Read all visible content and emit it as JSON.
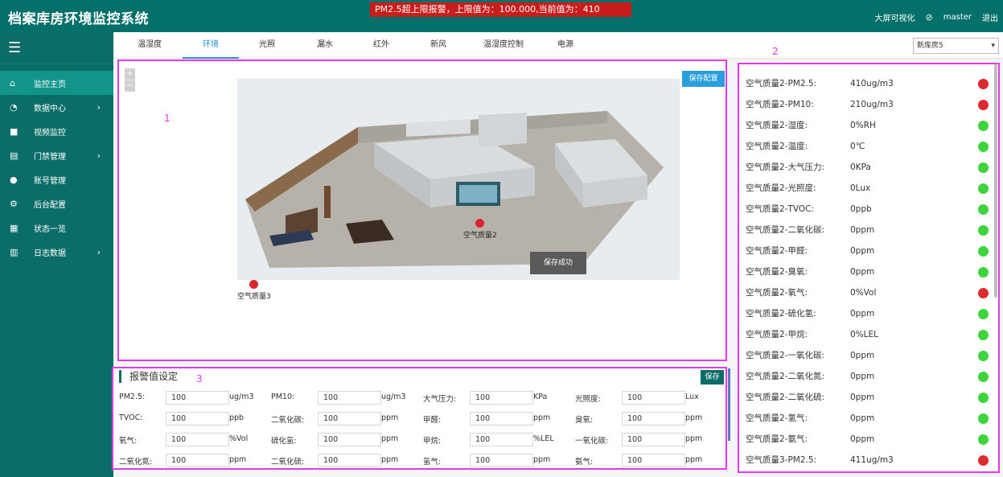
{
  "header": {
    "title": "档案库房环境监控系统",
    "alarm": "PM2.5超上限报警，上限值为：100.000,当前值为：410",
    "bigscreen": "大屏可视化",
    "user": "master",
    "logout": "退出"
  },
  "sidebar": {
    "items": [
      {
        "label": "监控主页",
        "icon": "home-icon"
      },
      {
        "label": "数据中心",
        "icon": "pie-chart-icon"
      },
      {
        "label": "视频监控",
        "icon": "video-camera-icon"
      },
      {
        "label": "门禁管理",
        "icon": "id-card-icon"
      },
      {
        "label": "账号管理",
        "icon": "user-icon"
      },
      {
        "label": "后台配置",
        "icon": "cogs-icon"
      },
      {
        "label": "状态一览",
        "icon": "list-icon"
      },
      {
        "label": "日志数据",
        "icon": "list-alt-icon"
      }
    ]
  },
  "tabs": [
    "温湿度",
    "环境",
    "光照",
    "漏水",
    "红外",
    "新风",
    "温湿度控制",
    "电源"
  ],
  "active_tab": "环境",
  "store_select": "新库房5",
  "panel_labels": {
    "p1": "1",
    "p2": "2",
    "p3": "3"
  },
  "map": {
    "save_config": "保存配置",
    "toast": "保存成功",
    "sensor2": "空气质量2",
    "sensor3": "空气质量3",
    "zoom_in": "+",
    "zoom_out": "−"
  },
  "status_list": [
    {
      "label": "空气质量2-PM2.5:",
      "value": "410ug/m3",
      "state": "red"
    },
    {
      "label": "空气质量2-PM10:",
      "value": "210ug/m3",
      "state": "red"
    },
    {
      "label": "空气质量2-湿度:",
      "value": "0%RH",
      "state": "green"
    },
    {
      "label": "空气质量2-温度:",
      "value": "0℃",
      "state": "green"
    },
    {
      "label": "空气质量2-大气压力:",
      "value": "0KPa",
      "state": "green"
    },
    {
      "label": "空气质量2-光照度:",
      "value": "0Lux",
      "state": "green"
    },
    {
      "label": "空气质量2-TVOC:",
      "value": "0ppb",
      "state": "green"
    },
    {
      "label": "空气质量2-二氧化碳:",
      "value": "0ppm",
      "state": "green"
    },
    {
      "label": "空气质量2-甲醛:",
      "value": "0ppm",
      "state": "green"
    },
    {
      "label": "空气质量2-臭氧:",
      "value": "0ppm",
      "state": "green"
    },
    {
      "label": "空气质量2-氧气:",
      "value": "0%Vol",
      "state": "red"
    },
    {
      "label": "空气质量2-硫化氢:",
      "value": "0ppm",
      "state": "green"
    },
    {
      "label": "空气质量2-甲烷:",
      "value": "0%LEL",
      "state": "green"
    },
    {
      "label": "空气质量2-一氧化碳:",
      "value": "0ppm",
      "state": "green"
    },
    {
      "label": "空气质量2-二氧化氮:",
      "value": "0ppm",
      "state": "green"
    },
    {
      "label": "空气质量2-二氧化硫:",
      "value": "0ppm",
      "state": "green"
    },
    {
      "label": "空气质量2-氢气:",
      "value": "0ppm",
      "state": "green"
    },
    {
      "label": "空气质量2-氨气:",
      "value": "0ppm",
      "state": "green"
    },
    {
      "label": "空气质量3-PM2.5:",
      "value": "411ug/m3",
      "state": "red"
    }
  ],
  "thresholds": {
    "title": "报警值设定",
    "save": "保存",
    "rows": [
      [
        {
          "label": "PM2.5:",
          "value": "100",
          "unit": "ug/m3"
        },
        {
          "label": "PM10:",
          "value": "100",
          "unit": "ug/m3"
        },
        {
          "label": "大气压力:",
          "value": "100",
          "unit": "KPa"
        },
        {
          "label": "光照度:",
          "value": "100",
          "unit": "Lux"
        }
      ],
      [
        {
          "label": "TVOC:",
          "value": "100",
          "unit": "ppb"
        },
        {
          "label": "二氧化碳:",
          "value": "100",
          "unit": "ppm"
        },
        {
          "label": "甲醛:",
          "value": "100",
          "unit": "ppm"
        },
        {
          "label": "臭氧:",
          "value": "100",
          "unit": "ppm"
        }
      ],
      [
        {
          "label": "氧气:",
          "value": "100",
          "unit": "%Vol"
        },
        {
          "label": "硫化氢:",
          "value": "100",
          "unit": "ppm"
        },
        {
          "label": "甲烷:",
          "value": "100",
          "unit": "%LEL"
        },
        {
          "label": "一氧化碳:",
          "value": "100",
          "unit": "ppm"
        }
      ],
      [
        {
          "label": "二氧化氮:",
          "value": "100",
          "unit": "ppm"
        },
        {
          "label": "二氧化硫:",
          "value": "100",
          "unit": "ppm"
        },
        {
          "label": "氢气:",
          "value": "100",
          "unit": "ppm"
        },
        {
          "label": "氨气:",
          "value": "100",
          "unit": "ppm"
        }
      ]
    ]
  },
  "colors": {
    "brand": "#0b6d67",
    "alarm": "#c81d1d",
    "active_tab": "#2a8fd8",
    "highlight_box": "#e13be8",
    "led_red": "#dc2a2e",
    "led_green": "#3ed43b"
  }
}
